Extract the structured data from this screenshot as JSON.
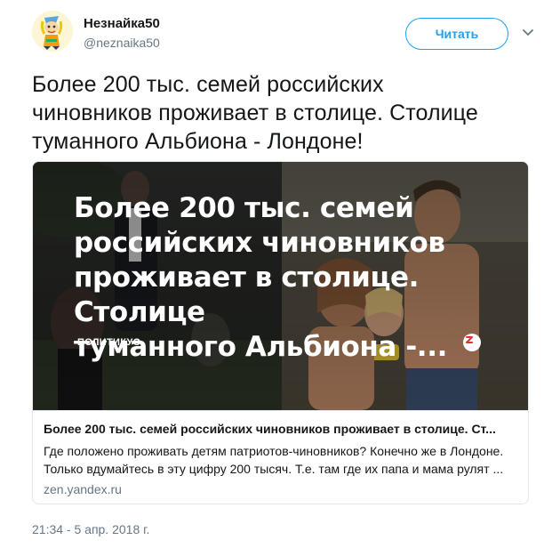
{
  "user": {
    "name": "Незнайка50",
    "handle": "@neznaika50"
  },
  "follow_button": {
    "label": "Читать",
    "color": "#1da1f2"
  },
  "menu_icon": "chevron-down-icon",
  "tweet": {
    "lines": [
      "Более 200 тыс. семей российских",
      "чиновников проживает в столице. Столице",
      "туманного Альбиона - Лондоне!"
    ]
  },
  "card": {
    "image": {
      "overlay_lines": [
        "Более 200 тыс. семей",
        "российских чиновников",
        "проживает в столице. Столице",
        "туманного Альбиона -..."
      ],
      "source_label": "ПОЛИТИКУС",
      "zen_icon": "zen-logo-icon"
    },
    "title": "Более 200 тыс. семей российских чиновников проживает в столице. Ст...",
    "description_lines": [
      "Где положено проживать детям патриотов-чиновников? Конечно же в Лондоне.",
      "Только вдумайтесь в эту цифру 200 тысяч. Т.е. там где их папа и мама рулят ..."
    ],
    "domain": "zen.yandex.ru"
  },
  "timestamp": "21:34 - 5 апр. 2018 г."
}
